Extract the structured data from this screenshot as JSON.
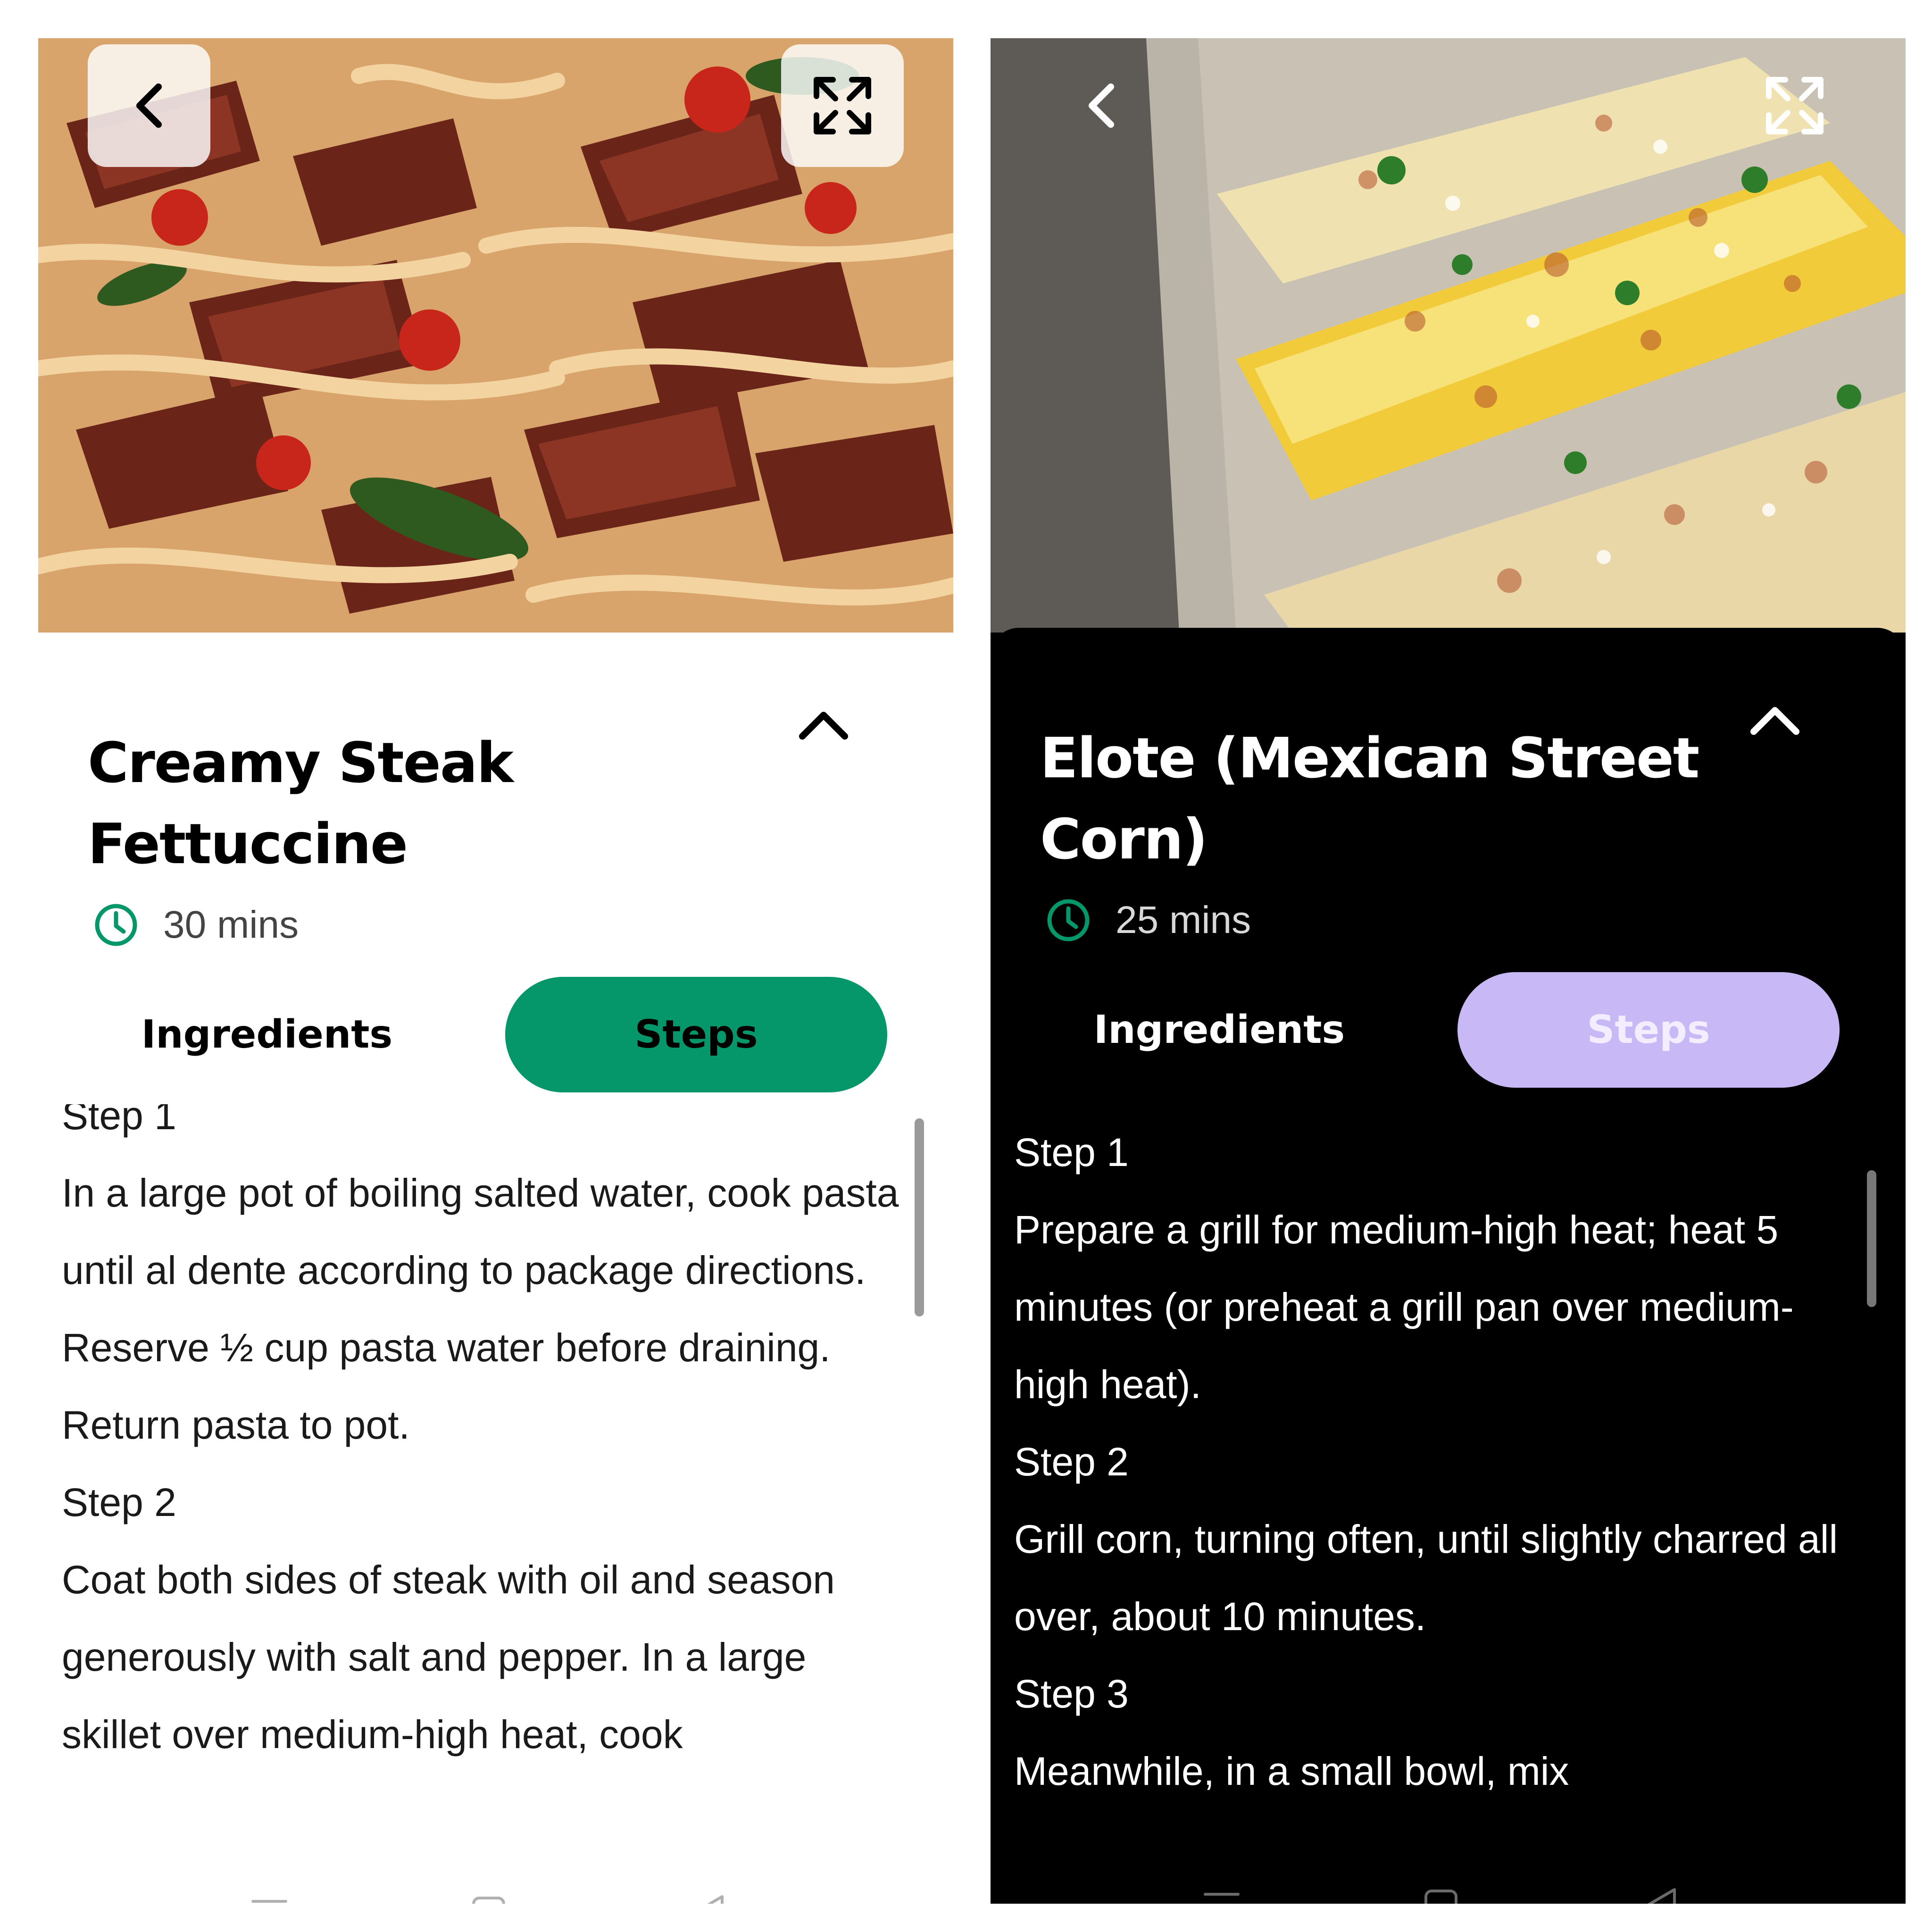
{
  "screens": [
    {
      "recipe": {
        "title": "Creamy Steak Fettuccine",
        "time": "30 mins"
      },
      "tabs": {
        "ingredients": "Ingredients",
        "steps": "Steps"
      },
      "steps": [
        {
          "label": "Step 1",
          "text": "In a large pot of boiling salted water, cook pasta until al dente according to package directions. Reserve ½ cup pasta water before draining. Return pasta to pot."
        },
        {
          "label": "Step 2",
          "text": "Coat both sides of steak with oil and season generously with salt and pepper. In a large skillet over medium-high heat, cook"
        }
      ],
      "theme": {
        "background": "#ffffff",
        "accent": "#059669",
        "text": "#000000"
      },
      "icons": [
        "back-icon",
        "expand-icon",
        "collapse-icon",
        "clock-icon",
        "menu-icon",
        "home-icon",
        "back-nav-icon"
      ]
    },
    {
      "recipe": {
        "title": "Elote (Mexican Street Corn)",
        "time": "25 mins"
      },
      "tabs": {
        "ingredients": "Ingredients",
        "steps": "Steps"
      },
      "steps": [
        {
          "label": "Step 1",
          "text": "Prepare a grill for medium-high heat; heat 5 minutes (or preheat a grill pan over medium-high heat)."
        },
        {
          "label": "Step 2",
          "text": "Grill corn, turning often, until slightly charred all over, about 10 minutes."
        },
        {
          "label": "Step 3",
          "text": "Meanwhile, in a small bowl, mix"
        }
      ],
      "theme": {
        "background": "#000000",
        "accent": "#c8b8f5",
        "text": "#ffffff"
      },
      "icons": [
        "back-icon",
        "expand-icon",
        "collapse-icon",
        "clock-icon",
        "menu-icon",
        "home-icon",
        "back-nav-icon"
      ]
    }
  ]
}
